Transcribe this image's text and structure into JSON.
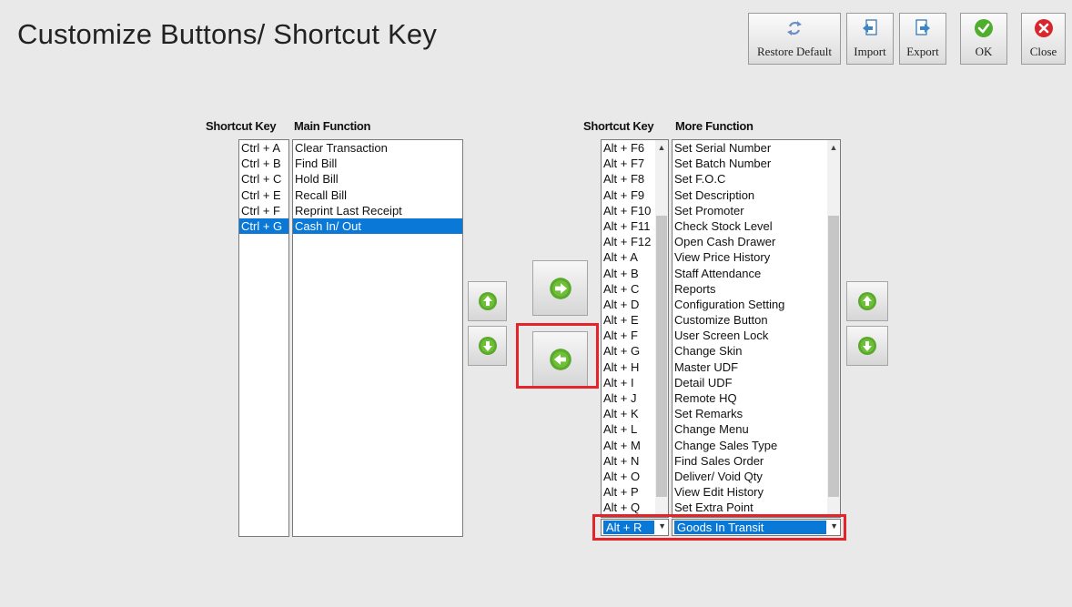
{
  "window": {
    "title": "Customize Buttons/ Shortcut Key"
  },
  "toolbar": {
    "restore_default": {
      "label": "Restore Default",
      "icon": "refresh-icon"
    },
    "import": {
      "label": "Import",
      "icon": "import-arrow-icon"
    },
    "export": {
      "label": "Export",
      "icon": "export-arrow-icon"
    },
    "ok": {
      "label": "OK",
      "icon": "check-circle-icon"
    },
    "close": {
      "label": "Close",
      "icon": "close-circle-icon"
    }
  },
  "main_panel": {
    "shortcut_header": "Shortcut Key",
    "function_header": "Main Function",
    "items": [
      {
        "key": "Ctrl + A",
        "function": "Clear Transaction",
        "selected": false
      },
      {
        "key": "Ctrl + B",
        "function": "Find Bill",
        "selected": false
      },
      {
        "key": "Ctrl + C",
        "function": "Hold Bill",
        "selected": false
      },
      {
        "key": "Ctrl + E",
        "function": "Recall Bill",
        "selected": false
      },
      {
        "key": "Ctrl + F",
        "function": "Reprint Last Receipt",
        "selected": false
      },
      {
        "key": "Ctrl + G",
        "function": "Cash In/ Out",
        "selected": true
      }
    ]
  },
  "more_panel": {
    "shortcut_header": "Shortcut Key",
    "function_header": "More Function",
    "items": [
      {
        "key": "Alt + F6",
        "function": "Set Serial Number"
      },
      {
        "key": "Alt + F7",
        "function": "Set Batch Number"
      },
      {
        "key": "Alt + F8",
        "function": "Set F.O.C"
      },
      {
        "key": "Alt + F9",
        "function": "Set Description"
      },
      {
        "key": "Alt + F10",
        "function": "Set Promoter"
      },
      {
        "key": "Alt + F11",
        "function": "Check Stock Level"
      },
      {
        "key": "Alt + F12",
        "function": "Open Cash Drawer"
      },
      {
        "key": "Alt + A",
        "function": "View Price History"
      },
      {
        "key": "Alt + B",
        "function": "Staff Attendance"
      },
      {
        "key": "Alt + C",
        "function": "Reports"
      },
      {
        "key": "Alt + D",
        "function": "Configuration Setting"
      },
      {
        "key": "Alt + E",
        "function": "Customize Button"
      },
      {
        "key": "Alt + F",
        "function": "User Screen Lock"
      },
      {
        "key": "Alt + G",
        "function": "Change Skin"
      },
      {
        "key": "Alt + H",
        "function": "Master UDF"
      },
      {
        "key": "Alt + I",
        "function": "Detail UDF"
      },
      {
        "key": "Alt + J",
        "function": "Remote HQ"
      },
      {
        "key": "Alt + K",
        "function": "Set Remarks"
      },
      {
        "key": "Alt + L",
        "function": "Change Menu"
      },
      {
        "key": "Alt + M",
        "function": "Change Sales Type"
      },
      {
        "key": "Alt + N",
        "function": "Find Sales Order"
      },
      {
        "key": "Alt + O",
        "function": "Deliver/ Void Qty"
      },
      {
        "key": "Alt + P",
        "function": "View Edit History"
      },
      {
        "key": "Alt + Q",
        "function": "Set Extra Point"
      }
    ],
    "selected_key": "Alt + R",
    "selected_function": "Goods In Transit"
  },
  "controls": {
    "move_up_icon": "arrow-up-circle-icon",
    "move_down_icon": "arrow-down-circle-icon",
    "transfer_right_icon": "arrow-right-circle-icon",
    "transfer_left_icon": "arrow-left-circle-icon"
  },
  "colors": {
    "selection": "#0a78d7",
    "highlight_box": "#e3242b",
    "icon_green": "#5aa82d"
  }
}
